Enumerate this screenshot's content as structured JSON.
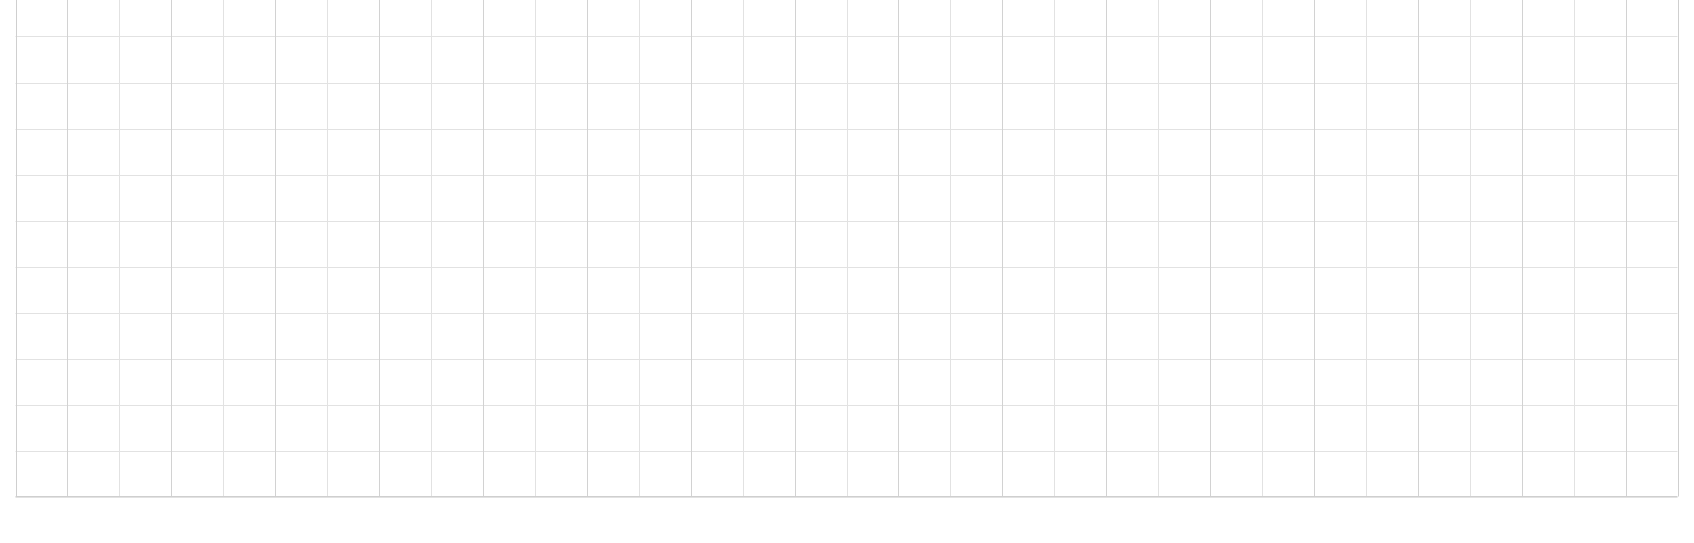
{
  "sheet": {
    "row_count": 11,
    "column_count": 32,
    "cells": [
      [
        "",
        "",
        "",
        "",
        "",
        "",
        "",
        "",
        "",
        "",
        "",
        "",
        "",
        "",
        "",
        "",
        "",
        "",
        "",
        "",
        "",
        "",
        "",
        "",
        "",
        "",
        "",
        "",
        "",
        "",
        "",
        ""
      ],
      [
        "",
        "",
        "",
        "",
        "",
        "",
        "",
        "",
        "",
        "",
        "",
        "",
        "",
        "",
        "",
        "",
        "",
        "",
        "",
        "",
        "",
        "",
        "",
        "",
        "",
        "",
        "",
        "",
        "",
        "",
        "",
        ""
      ],
      [
        "",
        "",
        "",
        "",
        "",
        "",
        "",
        "",
        "",
        "",
        "",
        "",
        "",
        "",
        "",
        "",
        "",
        "",
        "",
        "",
        "",
        "",
        "",
        "",
        "",
        "",
        "",
        "",
        "",
        "",
        "",
        ""
      ],
      [
        "",
        "",
        "",
        "",
        "",
        "",
        "",
        "",
        "",
        "",
        "",
        "",
        "",
        "",
        "",
        "",
        "",
        "",
        "",
        "",
        "",
        "",
        "",
        "",
        "",
        "",
        "",
        "",
        "",
        "",
        "",
        ""
      ],
      [
        "",
        "",
        "",
        "",
        "",
        "",
        "",
        "",
        "",
        "",
        "",
        "",
        "",
        "",
        "",
        "",
        "",
        "",
        "",
        "",
        "",
        "",
        "",
        "",
        "",
        "",
        "",
        "",
        "",
        "",
        "",
        ""
      ],
      [
        "",
        "",
        "",
        "",
        "",
        "",
        "",
        "",
        "",
        "",
        "",
        "",
        "",
        "",
        "",
        "",
        "",
        "",
        "",
        "",
        "",
        "",
        "",
        "",
        "",
        "",
        "",
        "",
        "",
        "",
        "",
        ""
      ],
      [
        "",
        "",
        "",
        "",
        "",
        "",
        "",
        "",
        "",
        "",
        "",
        "",
        "",
        "",
        "",
        "",
        "",
        "",
        "",
        "",
        "",
        "",
        "",
        "",
        "",
        "",
        "",
        "",
        "",
        "",
        "",
        ""
      ],
      [
        "",
        "",
        "",
        "",
        "",
        "",
        "",
        "",
        "",
        "",
        "",
        "",
        "",
        "",
        "",
        "",
        "",
        "",
        "",
        "",
        "",
        "",
        "",
        "",
        "",
        "",
        "",
        "",
        "",
        "",
        "",
        ""
      ],
      [
        "",
        "",
        "",
        "",
        "",
        "",
        "",
        "",
        "",
        "",
        "",
        "",
        "",
        "",
        "",
        "",
        "",
        "",
        "",
        "",
        "",
        "",
        "",
        "",
        "",
        "",
        "",
        "",
        "",
        "",
        "",
        ""
      ],
      [
        "",
        "",
        "",
        "",
        "",
        "",
        "",
        "",
        "",
        "",
        "",
        "",
        "",
        "",
        "",
        "",
        "",
        "",
        "",
        "",
        "",
        "",
        "",
        "",
        "",
        "",
        "",
        "",
        "",
        "",
        "",
        ""
      ],
      [
        "",
        "",
        "",
        "",
        "",
        "",
        "",
        "",
        "",
        "",
        "",
        "",
        "",
        "",
        "",
        "",
        "",
        "",
        "",
        "",
        "",
        "",
        "",
        "",
        "",
        "",
        "",
        "",
        "",
        "",
        "",
        ""
      ]
    ]
  },
  "colors": {
    "background": "#ffffff",
    "gridline": "#e2e2e2",
    "gridline_major": "#d2d2d2",
    "outer_border": "#cfcfcf"
  }
}
